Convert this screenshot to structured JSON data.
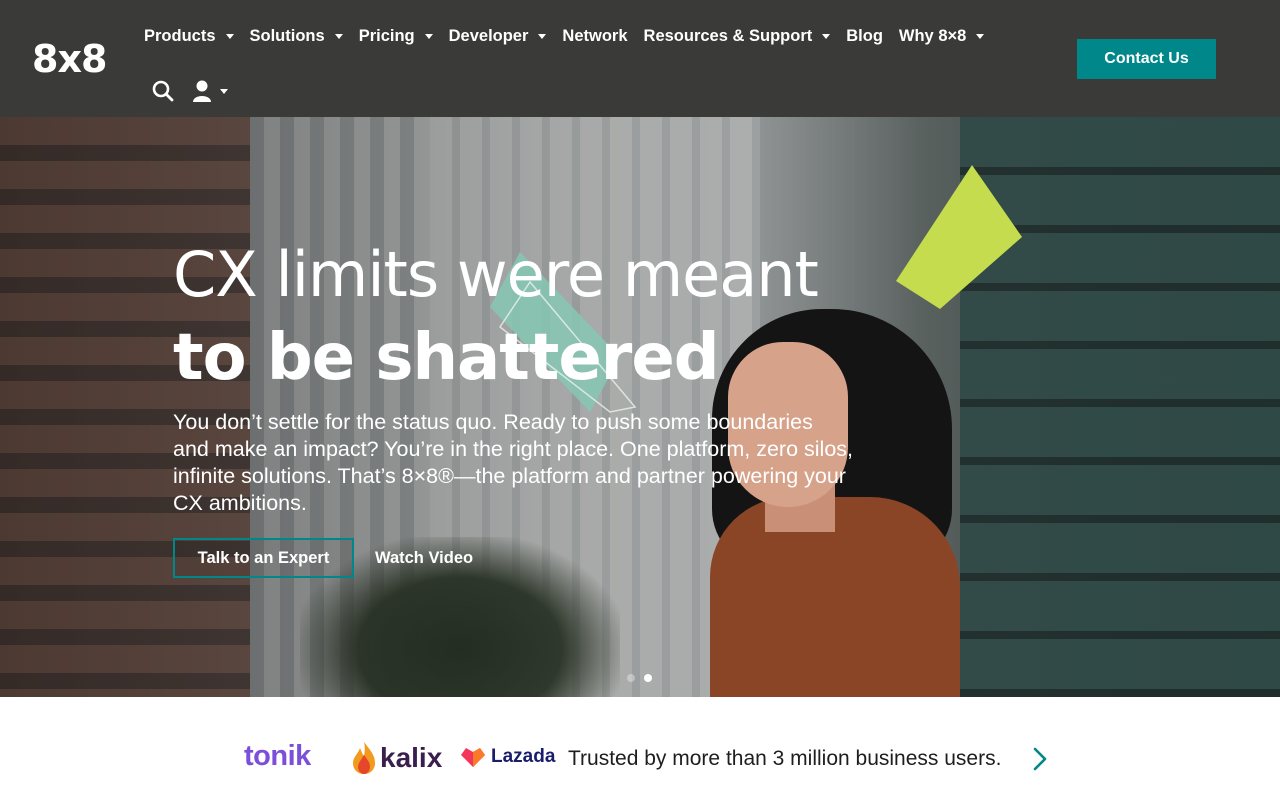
{
  "brand": {
    "logo_text": "8x8",
    "accent": "#00878a",
    "header_bg": "#3a3a39"
  },
  "nav": {
    "items": [
      {
        "label": "Products",
        "has_dropdown": true
      },
      {
        "label": "Solutions",
        "has_dropdown": true
      },
      {
        "label": "Pricing",
        "has_dropdown": true
      },
      {
        "label": "Developer",
        "has_dropdown": true
      },
      {
        "label": "Network",
        "has_dropdown": false
      },
      {
        "label": "Resources & Support",
        "has_dropdown": true
      },
      {
        "label": "Blog",
        "has_dropdown": false
      },
      {
        "label": "Why 8×8",
        "has_dropdown": true
      }
    ],
    "contact_label": "Contact Us",
    "icons": [
      "search-icon",
      "user-icon",
      "chevron-down-icon"
    ]
  },
  "hero": {
    "headline_line1": "CX limits were meant",
    "headline_line2": "to be shattered",
    "lead": "You don’t settle for the status quo. Ready to push some boundaries and make an impact? You’re in the right place. One platform, zero silos, infinite solutions. That’s 8×8®—the platform and partner powering your CX ambitions.",
    "primary_cta": "Talk to an Expert",
    "secondary_cta": "Watch Video",
    "carousel": {
      "slides": 2,
      "active": 2
    },
    "shape_colors": {
      "lime": "#c4dc4e",
      "teal": "#86c7b4"
    }
  },
  "trust": {
    "logos": [
      "tonik",
      "kalix",
      "Lazada"
    ],
    "text": "Trusted by more than 3 million business users.",
    "arrow_icon": "chevron-right-icon",
    "colors": {
      "tonik": "#7b4fd9",
      "kalix": "#3a1f4e",
      "lazada": "#1a1d6b"
    }
  }
}
